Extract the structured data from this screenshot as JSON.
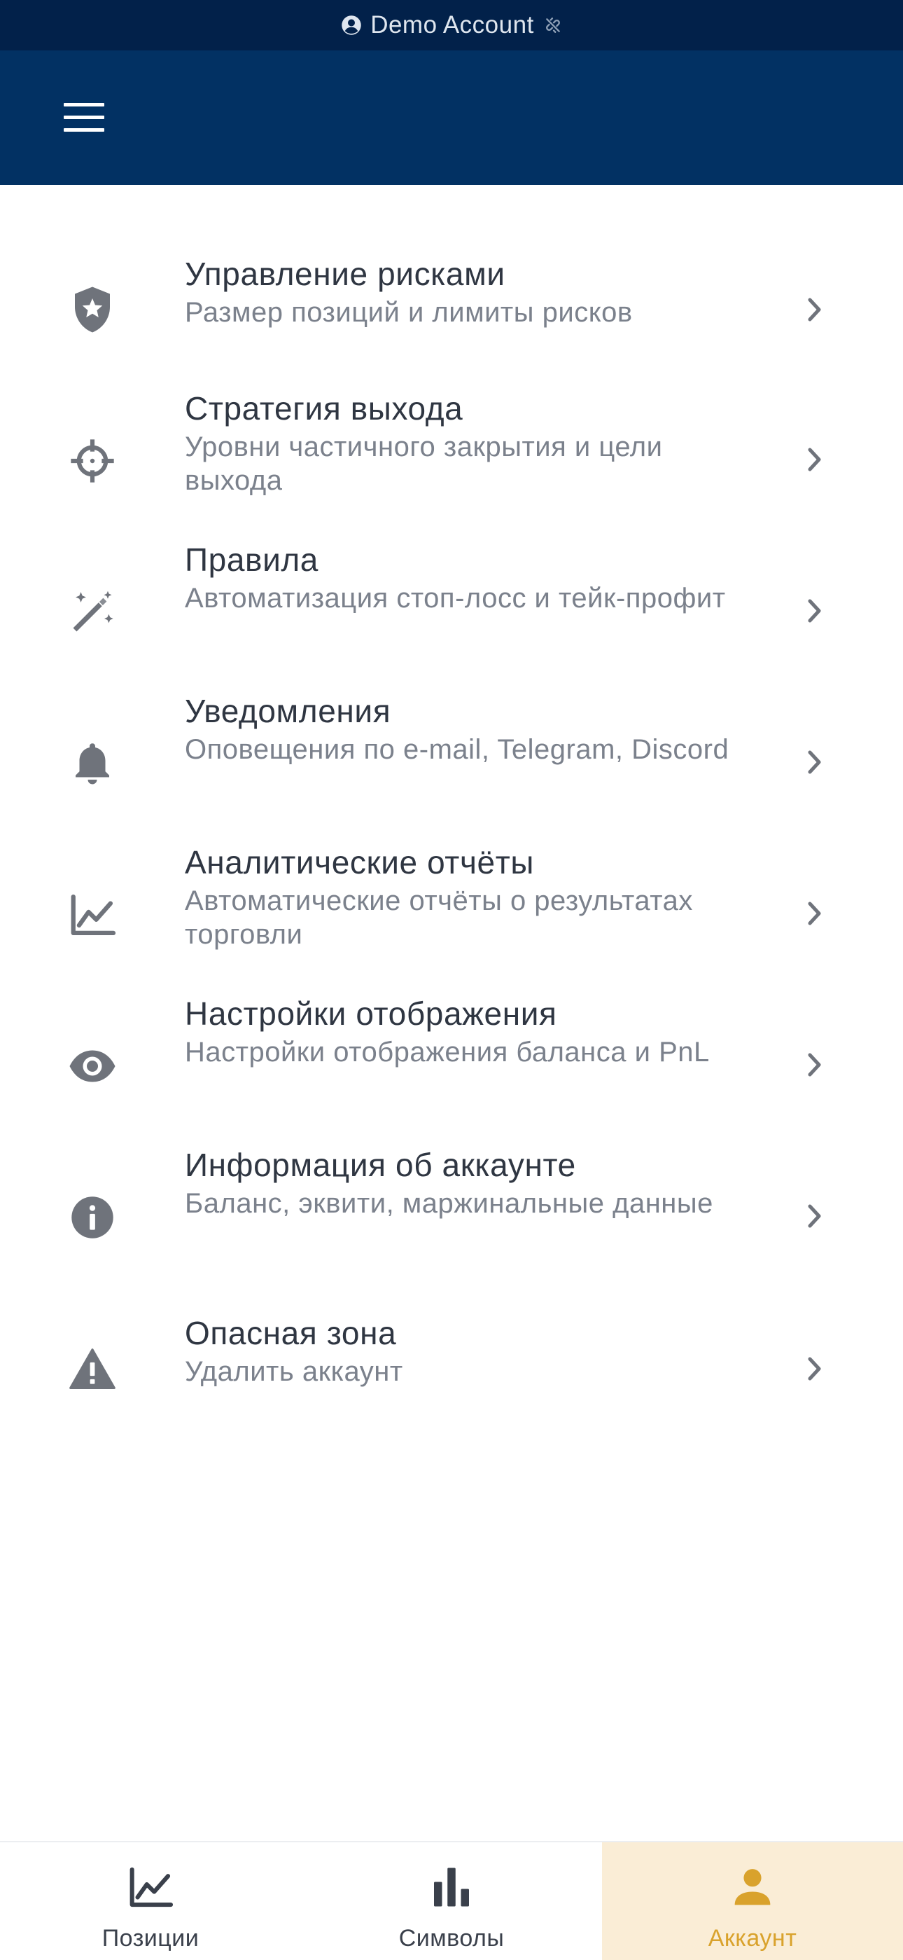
{
  "status_bar": {
    "account_label": "Demo Account"
  },
  "settings": {
    "items": [
      {
        "title": "Управление рисками",
        "subtitle": "Размер позиций и лимиты рисков"
      },
      {
        "title": "Стратегия выхода",
        "subtitle": "Уровни частичного закрытия и цели выхода"
      },
      {
        "title": "Правила",
        "subtitle": "Автоматизация стоп-лосс и тейк-профит"
      },
      {
        "title": "Уведомления",
        "subtitle": "Оповещения по e-mail, Telegram, Discord"
      },
      {
        "title": "Аналитические отчёты",
        "subtitle": "Автоматические отчёты о результатах торговли"
      },
      {
        "title": "Настройки отображения",
        "subtitle": "Настройки отображения баланса и PnL"
      },
      {
        "title": "Информация об аккаунте",
        "subtitle": "Баланс, эквити, маржинальные данные"
      },
      {
        "title": "Опасная зона",
        "subtitle": "Удалить аккаунт"
      }
    ]
  },
  "bottom_nav": {
    "positions_label": "Позиции",
    "symbols_label": "Символы",
    "account_label": "Аккаунт"
  },
  "colors": {
    "status_bar_bg": "#02214a",
    "header_bg": "#023163",
    "icon_gray": "#6f737b",
    "active_accent": "#d9a22c",
    "active_tab_bg": "#faedd6"
  },
  "icons": {
    "status_bar": [
      "account-circle-icon",
      "link-off-icon"
    ],
    "header": [
      "hamburger-menu-icon"
    ],
    "items": [
      "shield-star-icon",
      "crosshair-icon",
      "magic-wand-icon",
      "bell-icon",
      "chart-line-icon",
      "eye-icon",
      "info-icon",
      "warning-icon"
    ],
    "bottom_nav": [
      "chart-line-icon",
      "bar-chart-icon",
      "person-icon"
    ]
  }
}
